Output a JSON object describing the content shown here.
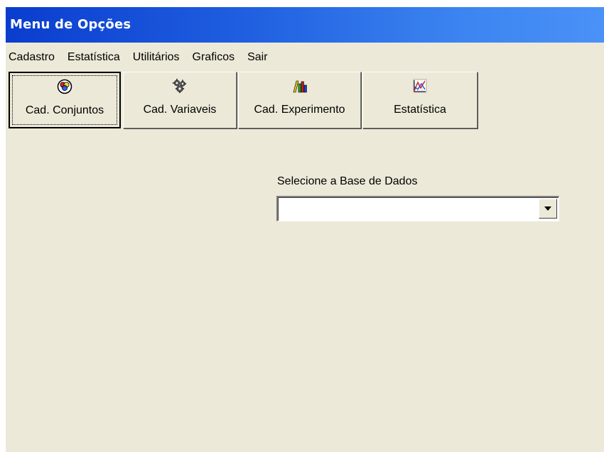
{
  "window": {
    "title": "Menu de Opções"
  },
  "menu": {
    "items": [
      {
        "label": "Cadastro"
      },
      {
        "label": "Estatística"
      },
      {
        "label": "Utilitários"
      },
      {
        "label": "Graficos"
      },
      {
        "label": "Sair"
      }
    ]
  },
  "toolbar": {
    "buttons": [
      {
        "label": "Cad. Conjuntos",
        "icon": "venn-diagram-icon",
        "active": true
      },
      {
        "label": "Cad. Variaveis",
        "icon": "gear-cluster-icon",
        "active": false
      },
      {
        "label": "Cad. Experimento",
        "icon": "bar-chart-icon",
        "active": false
      },
      {
        "label": "Estatística",
        "icon": "line-graph-icon",
        "active": false
      }
    ]
  },
  "database": {
    "label": "Selecione a Base de Dados",
    "selected": ""
  },
  "colors": {
    "titlebar_start": "#0a3dce",
    "titlebar_end": "#4a92f7",
    "window_bg": "#ece9d8"
  }
}
